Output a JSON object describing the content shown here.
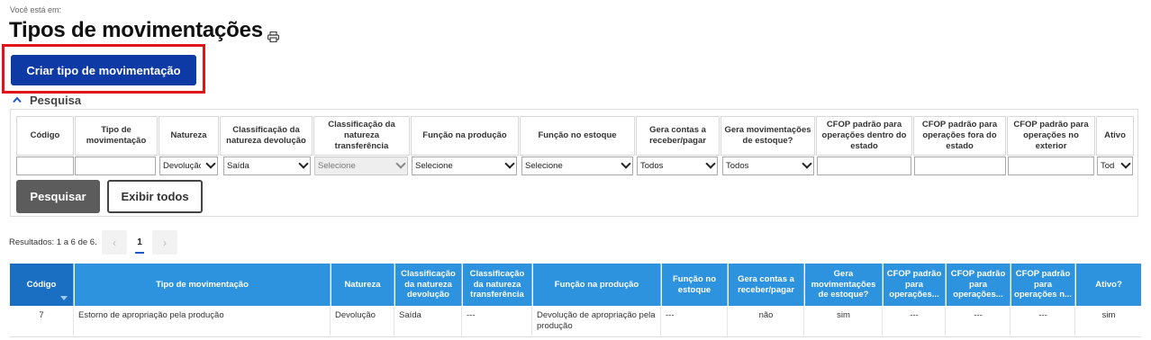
{
  "breadcrumb": "Você está em:",
  "title": "Tipos de movimentações",
  "print_icon": "printer-icon",
  "create_button": "Criar tipo de movimentação",
  "search_toggle": "Pesquisa",
  "filters": {
    "headers": [
      "Código",
      "Tipo de movimentação",
      "Natureza",
      "Classificação da natureza devolução",
      "Classificação da natureza transferência",
      "Função na produção",
      "Função no estoque",
      "Gera contas a receber/pagar",
      "Gera movimentações de estoque?",
      "CFOP padrão para operações dentro do estado",
      "CFOP padrão para operações fora do estado",
      "CFOP padrão para operações no exterior",
      "Ativo"
    ],
    "values": [
      "",
      "",
      "Devolução",
      "Saída",
      "Selecione",
      "Selecione",
      "Selecione",
      "Todos",
      "Todos",
      "",
      "",
      "",
      "Todos"
    ]
  },
  "search_button": "Pesquisar",
  "show_all_button": "Exibir todos",
  "results_text": "Resultados: 1 a 6 de 6.",
  "pagination": {
    "prev": "‹",
    "current": "1",
    "next": "›"
  },
  "table": {
    "columns": [
      "Código",
      "Tipo de movimentação",
      "Natureza",
      "Classificação da natureza devolução",
      "Classificação da natureza transferência",
      "Função na produção",
      "Função no estoque",
      "Gera contas a receber/pagar",
      "Gera movimentações de estoque?",
      "CFOP padrão para operações...",
      "CFOP padrão para operações...",
      "CFOP padrão para operações n...",
      "Ativo?"
    ],
    "rows": [
      [
        "7",
        "Estorno de apropriação pela produção",
        "Devolução",
        "Saída",
        "---",
        "Devolução de apropriação pela produção",
        "---",
        "não",
        "sim",
        "---",
        "---",
        "---",
        "sim"
      ]
    ]
  }
}
